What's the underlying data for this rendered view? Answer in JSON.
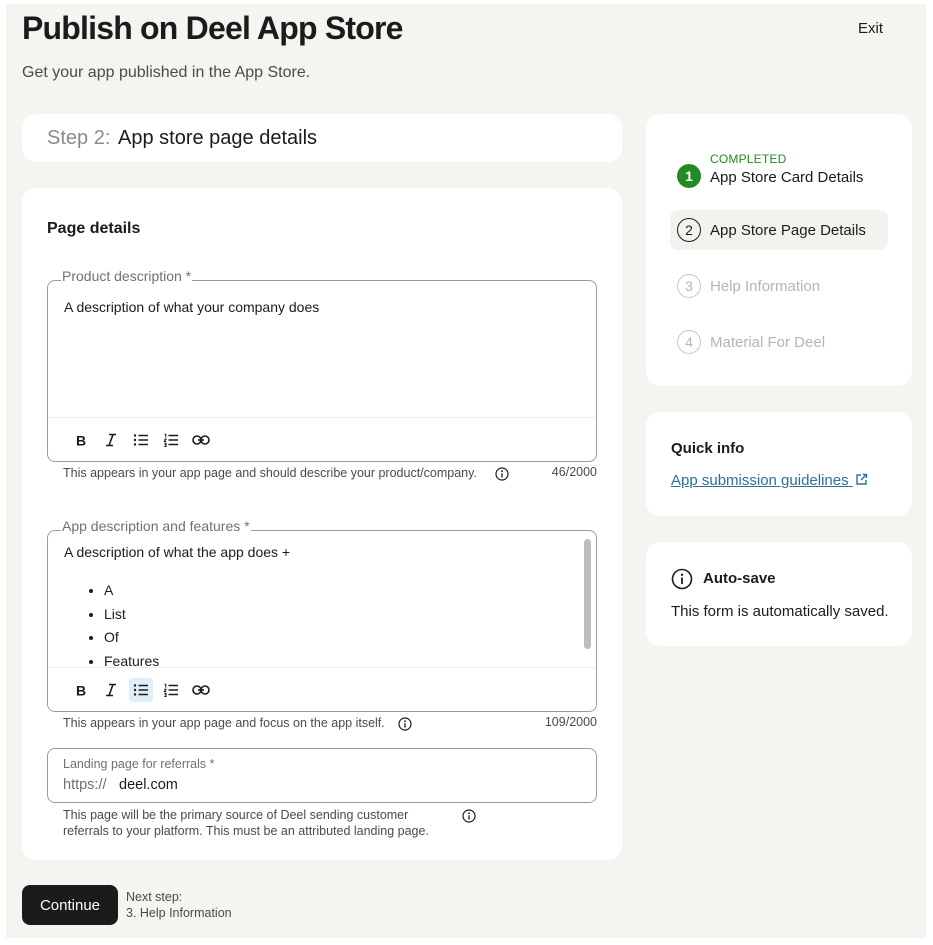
{
  "header": {
    "title": "Publish on Deel App Store",
    "subtitle": "Get your app published in the App Store.",
    "exit_label": "Exit"
  },
  "step_header": {
    "prefix": "Step 2:",
    "name": "App store page details"
  },
  "form": {
    "section_title": "Page details",
    "product_description": {
      "label": "Product description *",
      "value": "A description of what your company does",
      "helper": "This appears in your app page and should describe your product/company.",
      "count": "46",
      "max": "2000"
    },
    "app_description": {
      "label": "App description and features *",
      "intro": "A description of what the app does +",
      "bullets": [
        "A",
        "List",
        "Of",
        "Features"
      ],
      "helper": "This appears in your app page and focus on the app itself.",
      "count": "109",
      "max": "2000"
    },
    "landing_page": {
      "label": "Landing page for referrals *",
      "prefix": "https://",
      "value": "deel.com",
      "helper_line1": "This page will be the primary source of Deel sending customer",
      "helper_line2": "referrals to your platform. This must be an attributed landing page."
    },
    "toolbar_icons": [
      "bold-icon",
      "italic-icon",
      "bullet-list-icon",
      "numbered-list-icon",
      "link-icon"
    ]
  },
  "stepper": {
    "steps": [
      {
        "number": "1",
        "label": "App Store Card Details",
        "status": "COMPLETED",
        "state": "done"
      },
      {
        "number": "2",
        "label": "App Store Page Details",
        "state": "current"
      },
      {
        "number": "3",
        "label": "Help Information",
        "state": "todo"
      },
      {
        "number": "4",
        "label": "Material For Deel",
        "state": "todo"
      }
    ]
  },
  "quick_info": {
    "title": "Quick info",
    "link_label": "App submission guidelines"
  },
  "autosave": {
    "title": "Auto-save",
    "text": "This form is automatically saved."
  },
  "footer": {
    "continue_label": "Continue",
    "next_step_label": "Next step:",
    "next_step_value": "3. Help Information"
  },
  "colors": {
    "background": "#f5f4f1",
    "primary_button": "#1b1b1b",
    "completed_green": "#228b22",
    "link_blue": "#2e6f9e",
    "active_toolbar": "#deeffa"
  }
}
